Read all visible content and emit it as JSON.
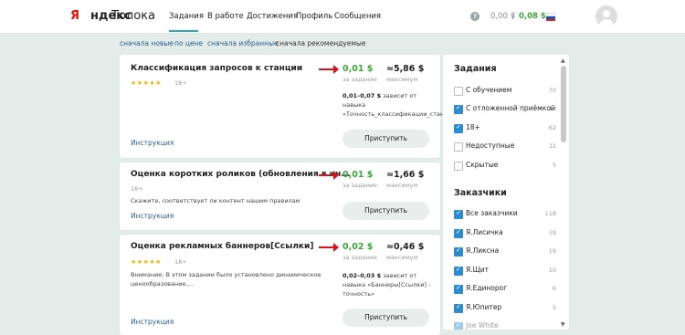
{
  "header": {
    "logo_red": "Я",
    "logo_rest": "ндекс",
    "logo_sub": "Толока",
    "nav": [
      "Задания",
      "В работе",
      "Достижения",
      "Профиль",
      "Сообщения"
    ],
    "balance_pending": "0,00 $",
    "balance_sep": "/",
    "balance_available": "0,08 $",
    "help": "?"
  },
  "sort": {
    "options": [
      "сначала новые",
      "по цене",
      "сначала избранные",
      "сначала рекомендуемые"
    ]
  },
  "tasks": [
    {
      "title": "Классификация запросов к станции",
      "stars": "★★★★★",
      "age": "18+",
      "price": "0,01 $",
      "price_label": "за задание",
      "max": "≈5,86 $",
      "max_label": "максимум",
      "range": "0,01–0,07 $",
      "range_text1": " зависит от",
      "range_text2": "навыка",
      "range_text3": "«Точность_классификации_стан",
      "instruction": "Инструкция",
      "button": "Приступить"
    },
    {
      "title": "Оценка коротких роликов (обновления в ин...",
      "age": "18+",
      "description": "Скажите, соответствует ли контент нашим правилам",
      "price": "0,01 $",
      "price_label": "за задание",
      "max": "≈1,66 $",
      "max_label": "максимум",
      "instruction": "Инструкция",
      "button": "Приступить"
    },
    {
      "title": "Оценка рекламных баннеров[Ссылки]",
      "stars": "★★★★★",
      "age": "18+",
      "description_line1": "Внимание: В этом задании было установлено динамическое",
      "description_line2": "ценообразование....",
      "price": "0,02 $",
      "price_label": "за задание",
      "max": "≈0,46 $",
      "max_label": "максимум",
      "range": "0,02–0,03 $",
      "range_text1": " зависит от",
      "range_text2": "навыка «Баннеры[Ссылки] -",
      "range_text3": "точность»",
      "instruction": "Инструкция",
      "button": "Приступить"
    }
  ],
  "sidebar": {
    "tasks_heading": "Задания",
    "task_filters": [
      {
        "label": "С обучением",
        "count": "70",
        "checked": false
      },
      {
        "label": "С отложенной приёмкой",
        "count": "10",
        "checked": true
      },
      {
        "label": "18+",
        "count": "62",
        "checked": true
      },
      {
        "label": "Недоступные",
        "count": "32",
        "checked": false
      },
      {
        "label": "Скрытые",
        "count": "5",
        "checked": false
      }
    ],
    "requesters_heading": "Заказчики",
    "requester_filters": [
      {
        "label": "Все заказчики",
        "count": "118",
        "checked": true
      },
      {
        "label": "Я.Лисичка",
        "count": "19",
        "checked": true
      },
      {
        "label": "Я.Ликсна",
        "count": "19",
        "checked": true
      },
      {
        "label": "Я.Щит",
        "count": "10",
        "checked": true
      },
      {
        "label": "Я.Единорог",
        "count": "6",
        "checked": true
      },
      {
        "label": "Я.Юпитер",
        "count": "5",
        "checked": true
      },
      {
        "label": "Joe White",
        "count": "",
        "checked": true
      }
    ]
  },
  "colors": {
    "accent": "#2fa9b3",
    "price_green": "#3fa33c",
    "link_blue": "#285f8f",
    "arrow_red": "#e0101a",
    "logo_red": "#e61400"
  }
}
